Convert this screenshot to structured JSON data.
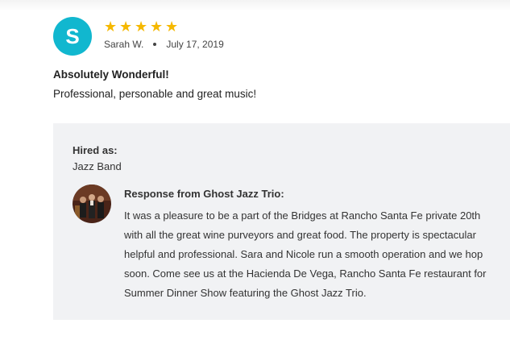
{
  "review": {
    "avatar_initial": "S",
    "rating_stars": 5,
    "star_glyph": "★",
    "author": "Sarah W.",
    "date": "July 17, 2019",
    "title": "Absolutely Wonderful!",
    "body": "Professional, personable and great music!"
  },
  "details": {
    "hired_label": "Hired as:",
    "hired_value": "Jazz Band"
  },
  "response": {
    "title": "Response from Ghost Jazz Trio:",
    "lines": [
      "It was a pleasure to be a part of the Bridges at Rancho Santa Fe private 20th",
      "with all the great wine purveyors and great food. The property is spectacular",
      "helpful and professional. Sara and Nicole run a smooth operation and we hop",
      "soon. Come see us at the Hacienda De Vega, Rancho Santa Fe restaurant for",
      "Summer Dinner Show featuring the Ghost Jazz Trio."
    ]
  },
  "colors": {
    "avatar_bg": "#11b7cf",
    "star": "#f5b800",
    "panel_bg": "#f1f2f4"
  },
  "icons": {
    "star": "star-icon",
    "separator": "dot-separator-icon"
  }
}
